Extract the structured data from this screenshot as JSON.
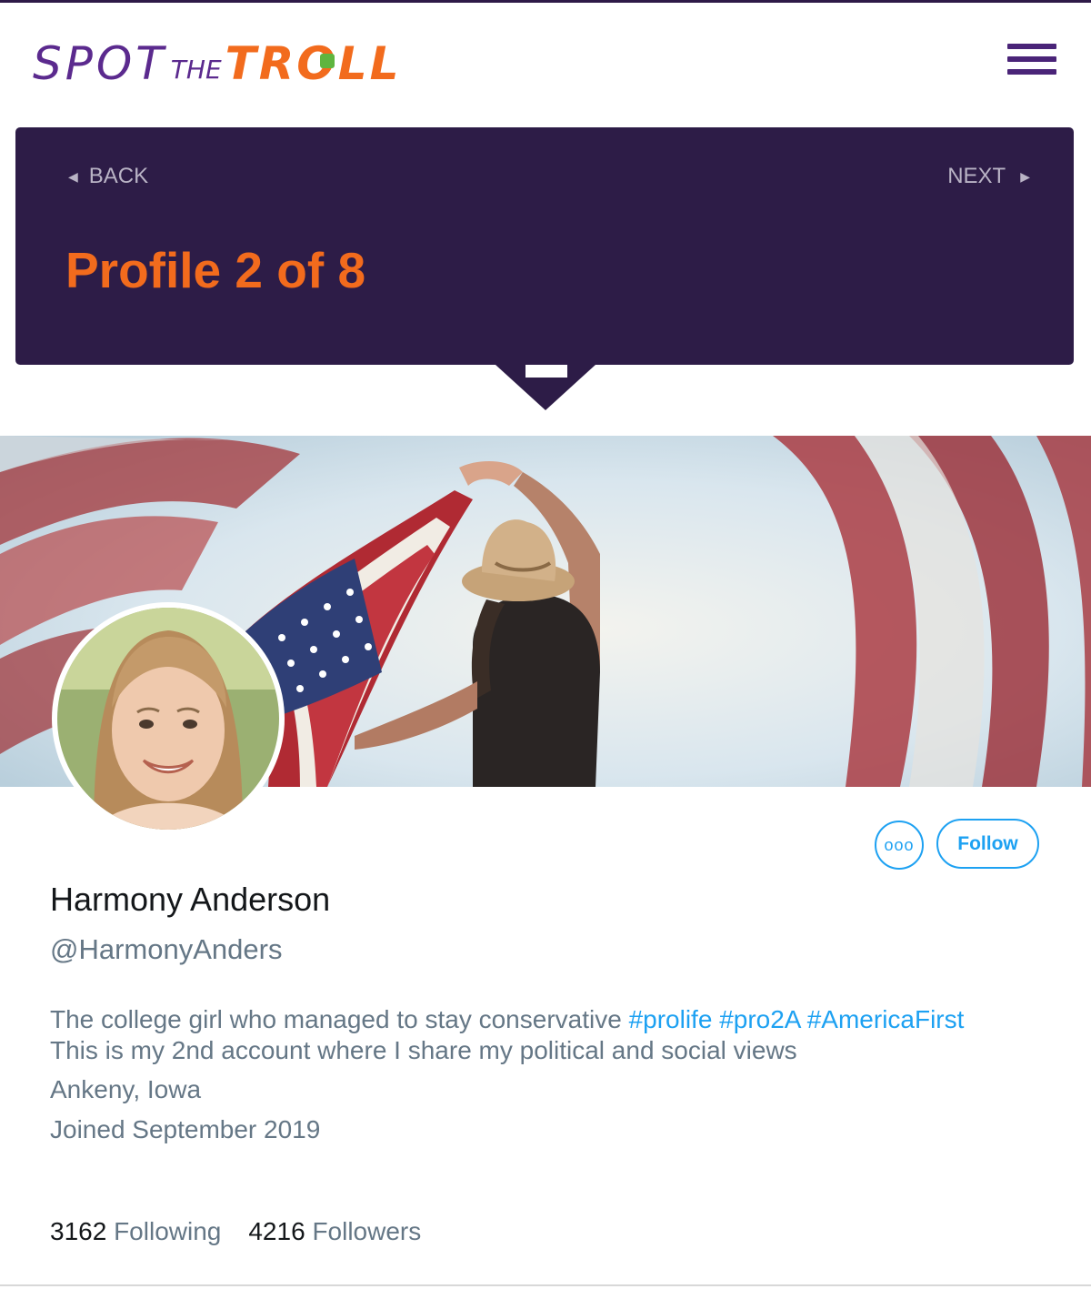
{
  "header": {
    "logo": {
      "part1": "SPOT",
      "part2": "THE",
      "part3": "TROLL"
    },
    "menu_icon": "hamburger-menu-icon"
  },
  "banner": {
    "back_label": "BACK",
    "next_label": "NEXT",
    "title": "Profile 2 of 8"
  },
  "profile": {
    "name": "Harmony Anderson",
    "handle": "@HarmonyAnders",
    "bio_text": "The college girl who managed to stay conservative ",
    "bio_tags": [
      "#prolife",
      "#pro2A",
      "#AmericaFirst"
    ],
    "bio_line2": "This is my 2nd account where I share my political and social views",
    "location": "Ankeny, Iowa",
    "joined": "Joined September 2019",
    "following_count": "3162",
    "following_label": "Following",
    "followers_count": "4216",
    "followers_label": "Followers"
  },
  "actions": {
    "more_label": "ooo",
    "follow_label": "Follow"
  },
  "colors": {
    "brand_purple": "#2d1c47",
    "brand_orange": "#f26b1d",
    "link_blue": "#1da1f2"
  }
}
